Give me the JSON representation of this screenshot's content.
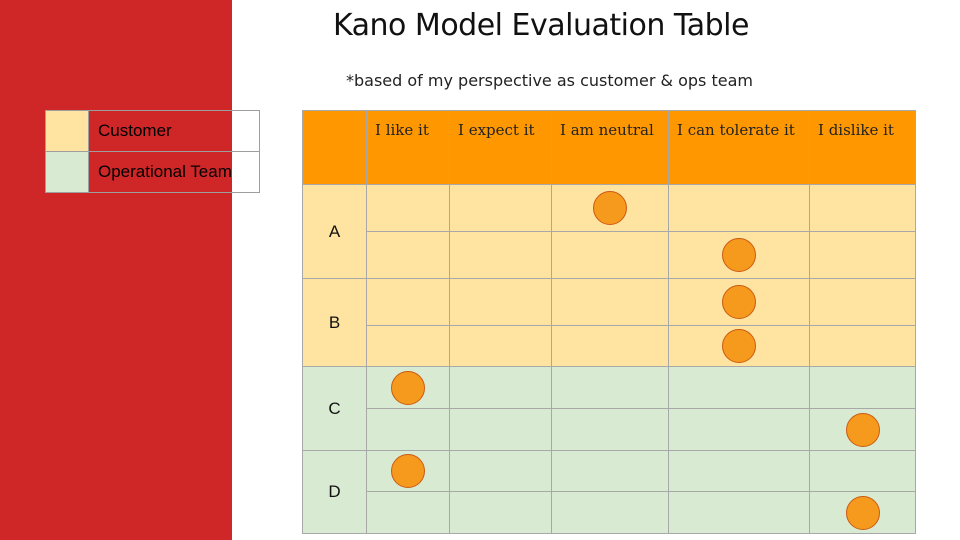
{
  "slide": {
    "title": "Kano Model Evaluation Table",
    "subtitle": "*based of my perspective as customer & ops team"
  },
  "legend": [
    {
      "label": "Customer",
      "color": "#fee3a1"
    },
    {
      "label": "Operational Team",
      "color": "#d9ead3"
    }
  ],
  "table": {
    "columns": [
      "I like it",
      "I expect it",
      "I am neutral",
      "I can tolerate it",
      "I dislike it"
    ],
    "groups": [
      {
        "label": "A",
        "marks": [
          2,
          3
        ]
      },
      {
        "label": "B",
        "marks": [
          3,
          3
        ]
      },
      {
        "label": "C",
        "marks": [
          0,
          4
        ]
      },
      {
        "label": "D",
        "marks": [
          0,
          4
        ]
      }
    ]
  },
  "colors": {
    "sidebar": "#cf2628",
    "header": "#ff9800",
    "customer": "#fee3a1",
    "operational_team": "#d9ead3",
    "dot": "#f59a1d"
  }
}
